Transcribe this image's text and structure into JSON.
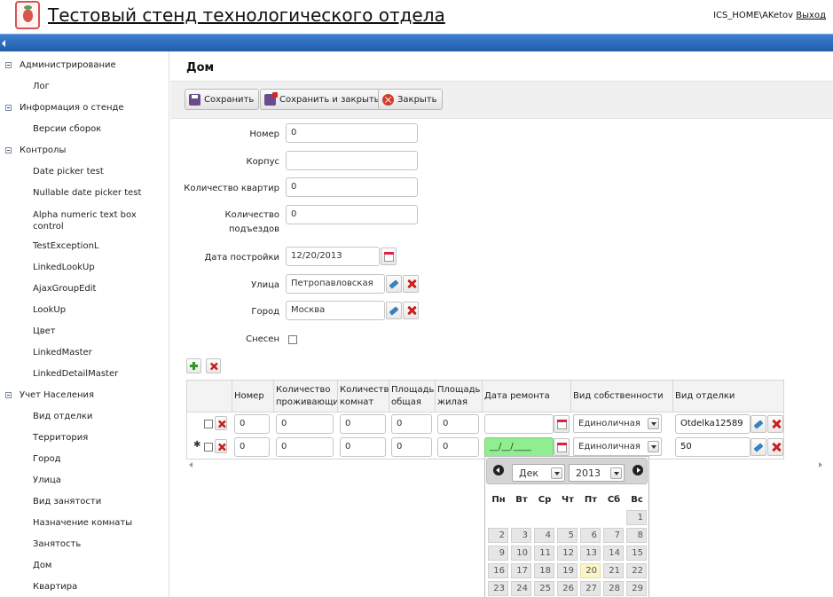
{
  "header": {
    "title": "Тестовый стенд технологического отдела",
    "user": "ICS_HOME\\AKetov",
    "logout_label": "Выход"
  },
  "sidebar": {
    "groups": [
      {
        "label": "Администрирование",
        "items": [
          "Лог"
        ]
      },
      {
        "label": "Информация о стенде",
        "items": [
          "Версии сборок"
        ]
      },
      {
        "label": "Контролы",
        "items": [
          "Date picker test",
          "Nullable date picker test",
          "Alpha numeric text box control",
          "TestExceptionL",
          "LinkedLookUp",
          "AjaxGroupEdit",
          "LookUp",
          "Цвет",
          "LinkedMaster",
          "LinkedDetailMaster"
        ]
      },
      {
        "label": "Учет Населения",
        "items": [
          "Вид отделки",
          "Территория",
          "Город",
          "Улица",
          "Вид занятости",
          "Назначение комнаты",
          "Занятость",
          "Дом",
          "Квартира"
        ]
      }
    ]
  },
  "page": {
    "title": "Дом"
  },
  "toolbar": {
    "save_label": "Сохранить",
    "save_close_label": "Сохранить и закрыть",
    "close_label": "Закрыть"
  },
  "form": {
    "number": {
      "label": "Номер",
      "value": "0"
    },
    "building": {
      "label": "Корпус",
      "value": ""
    },
    "apartments": {
      "label": "Количество квартир",
      "value": "0"
    },
    "entrances": {
      "label": "Количество подъездов",
      "value": "0"
    },
    "built_date": {
      "label": "Дата постройки",
      "value": "12/20/2013"
    },
    "street": {
      "label": "Улица",
      "value": "Петропавловская"
    },
    "city": {
      "label": "Город",
      "value": "Москва"
    },
    "demolished": {
      "label": "Снесен"
    }
  },
  "grid": {
    "columns": [
      "Номер",
      "Количество проживающих",
      "Количество комнат",
      "Площадь общая",
      "Площадь жилая",
      "Дата ремонта",
      "Вид собственности",
      "Вид отделки"
    ],
    "rows": [
      {
        "marker": "",
        "number": "0",
        "residents": "0",
        "rooms": "0",
        "area_total": "0",
        "area_living": "0",
        "repair_date": "",
        "ownership": "Единоличная",
        "finish": "Otdelka12589"
      },
      {
        "marker": "✱",
        "number": "0",
        "residents": "0",
        "rooms": "0",
        "area_total": "0",
        "area_living": "0",
        "repair_date": "__/__/____",
        "ownership": "Единоличная",
        "finish": "50"
      }
    ]
  },
  "datepicker": {
    "month": "Дек",
    "year": "2013",
    "weekdays": [
      "Пн",
      "Вт",
      "Ср",
      "Чт",
      "Пт",
      "Сб",
      "Вс"
    ],
    "days": [
      "1",
      "2",
      "3",
      "4",
      "5",
      "6",
      "7",
      "8",
      "9",
      "10",
      "11",
      "12",
      "13",
      "14",
      "15",
      "16",
      "17",
      "18",
      "19",
      "20",
      "21",
      "22",
      "23",
      "24",
      "25",
      "26",
      "27",
      "28",
      "29"
    ],
    "today": "20"
  },
  "colors": {
    "accent_bar": "#2a6bbd",
    "delete_red": "#c9201a",
    "add_green": "#2e9a2e",
    "active_date_field": "#90ee90"
  }
}
